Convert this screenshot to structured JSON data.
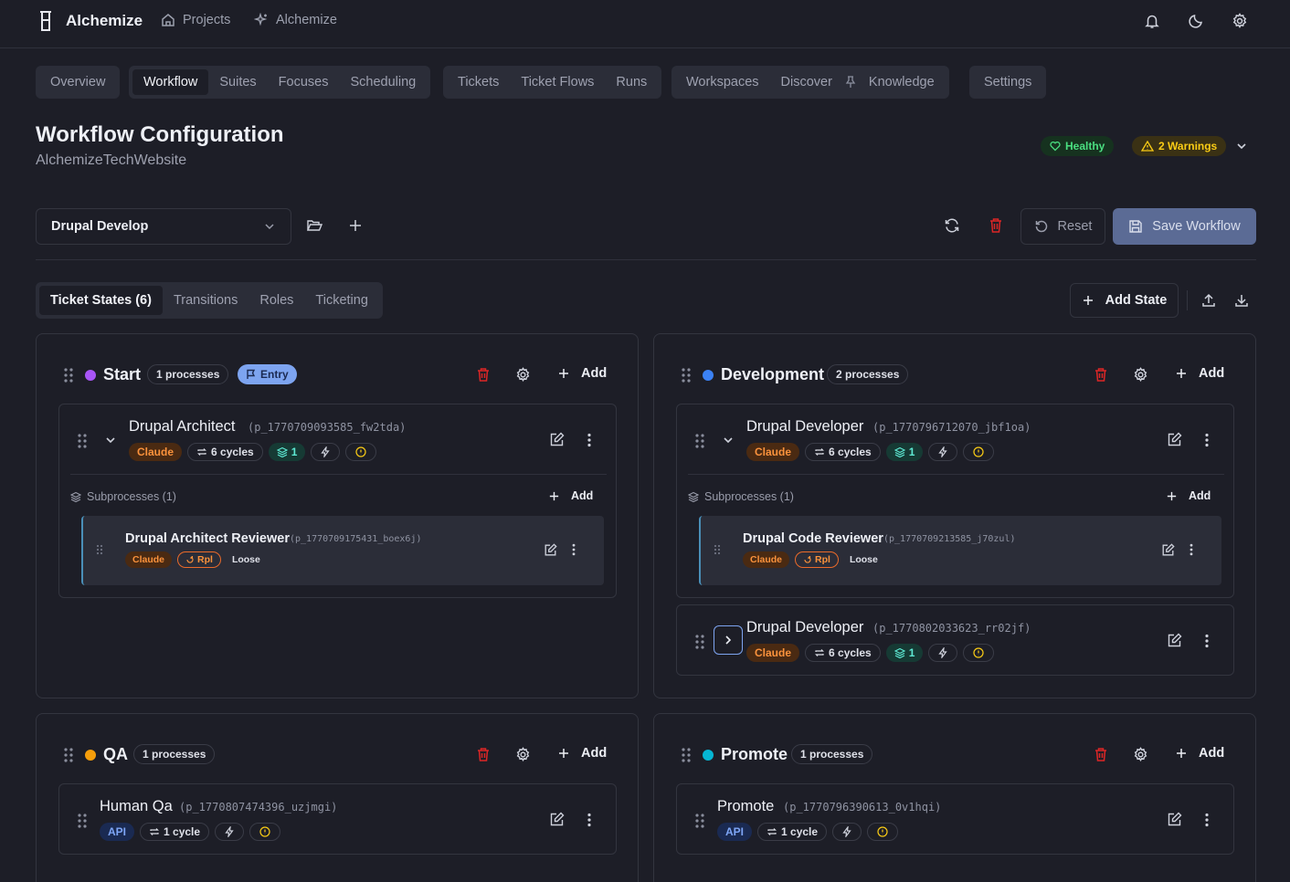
{
  "app": {
    "name": "Alchemize"
  },
  "topnav": {
    "projects": "Projects",
    "alchemize": "Alchemize"
  },
  "tabs": [
    [
      "Overview"
    ],
    [
      "Workflow",
      "Suites",
      "Focuses",
      "Scheduling"
    ],
    [
      "Tickets",
      "Ticket Flows",
      "Runs"
    ],
    [
      "Workspaces",
      "Discover",
      "Knowledge"
    ],
    [
      "Settings"
    ]
  ],
  "header": {
    "title": "Workflow Configuration",
    "subtitle": "AlchemizeTechWebsite",
    "healthy": "Healthy",
    "warnings": "2 Warnings"
  },
  "workflow": {
    "selected": "Drupal Develop",
    "reset": "Reset",
    "save": "Save Workflow"
  },
  "subtabs": [
    "Ticket States (6)",
    "Transitions",
    "Roles",
    "Ticketing"
  ],
  "add_state": "Add State",
  "add_label": "Add",
  "subprocesses_label": "Subprocesses (1)",
  "entry_label": "Entry",
  "states": {
    "start": {
      "name": "Start",
      "count": "1 processes",
      "color": "#a855f7",
      "proc": {
        "name": "Drupal Architect",
        "id": "(p_1770709093585_fw2tda)",
        "agent": "Claude",
        "cycles": "6 cycles",
        "subs": "1"
      },
      "sub": {
        "name": "Drupal Architect Reviewer",
        "id": "(p_1770709175431_boex6j)",
        "agent": "Claude",
        "rpl": "Rpl",
        "mode": "Loose"
      }
    },
    "development": {
      "name": "Development",
      "count": "2 processes",
      "color": "#3b82f6",
      "proc": {
        "name": "Drupal Developer",
        "id": "(p_1770796712070_jbf1oa)",
        "agent": "Claude",
        "cycles": "6 cycles",
        "subs": "1"
      },
      "sub": {
        "name": "Drupal Code Reviewer",
        "id": "(p_1770709213585_j70zul)",
        "agent": "Claude",
        "rpl": "Rpl",
        "mode": "Loose"
      },
      "proc2": {
        "name": "Drupal Developer",
        "id": "(p_1770802033623_rr02jf)",
        "agent": "Claude",
        "cycles": "6 cycles",
        "subs": "1"
      }
    },
    "qa": {
      "name": "QA",
      "count": "1 processes",
      "color": "#f59e0b",
      "proc": {
        "name": "Human Qa",
        "id": "(p_1770807474396_uzjmgi)",
        "agent": "API",
        "cycles": "1 cycle"
      }
    },
    "promote": {
      "name": "Promote",
      "count": "1 processes",
      "color": "#06b6d4",
      "proc": {
        "name": "Promote",
        "id": "(p_1770796390613_0v1hqi)",
        "agent": "API",
        "cycles": "1 cycle"
      }
    }
  },
  "colors": {
    "accent": "#5b6b95",
    "danger": "#dc2626",
    "healthy": "#4ade80",
    "warning": "#facc15"
  }
}
